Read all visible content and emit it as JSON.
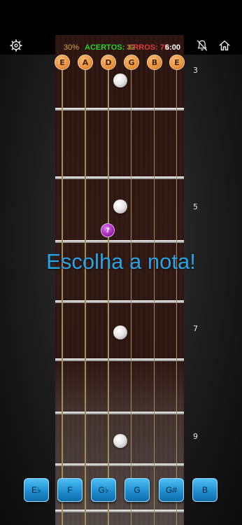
{
  "header": {
    "percent": "30%",
    "hits": "ACERTOS: 32",
    "errors": "ERROS: 75",
    "timer": "6:00"
  },
  "strings": {
    "open_notes": [
      "E",
      "A",
      "D",
      "G",
      "B",
      "E"
    ]
  },
  "fretboard": {
    "fret_numbers": [
      "3",
      "5",
      "7",
      "9"
    ],
    "question_mark": "?"
  },
  "prompt": "Escolha a nota!",
  "answers": [
    "E♭",
    "F",
    "G♭",
    "G",
    "G#",
    "B"
  ],
  "icons": {
    "settings": "gear-icon",
    "no_alerts": "bell-off-icon",
    "home": "home-icon"
  },
  "colors": {
    "accent": "#2aa3e6",
    "hits": "#2fd02f",
    "errors": "#e33b3b",
    "percent": "#e2a24a",
    "question": "#a526b8",
    "open_string": "#e9903a"
  }
}
